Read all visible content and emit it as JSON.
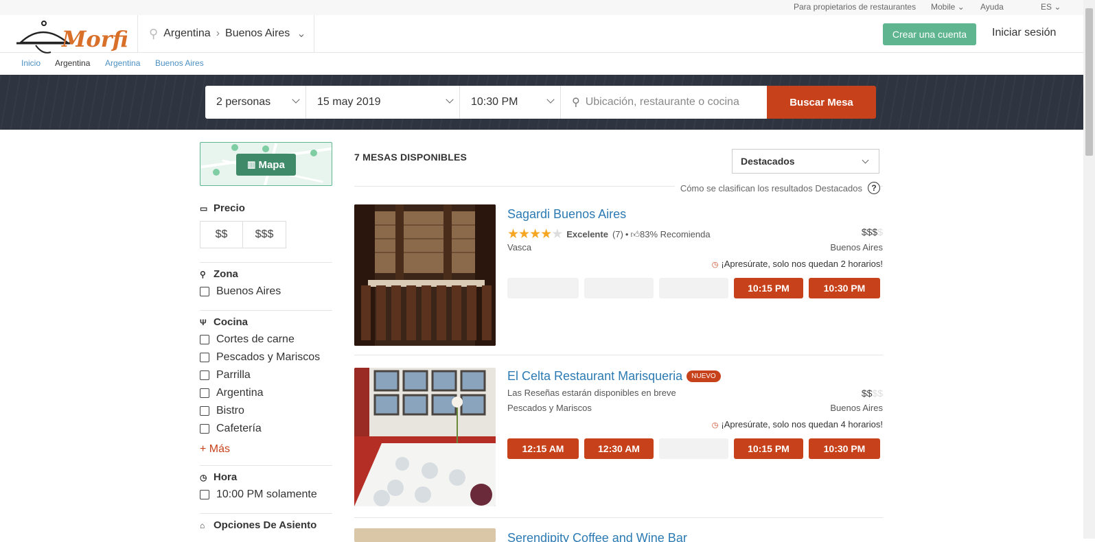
{
  "topbar": {
    "owners": "Para propietarios de restaurantes",
    "mobile": "Mobile",
    "help": "Ayuda",
    "lang": "ES"
  },
  "header": {
    "logo_text": "Morfi",
    "country": "Argentina",
    "city": "Buenos Aires",
    "create_account": "Crear una cuenta",
    "login": "Iniciar sesión"
  },
  "breadcrumb": [
    "Inicio",
    "Argentina",
    "Argentina",
    "Buenos Aires"
  ],
  "search": {
    "party": "2 personas",
    "date": "15 may 2019",
    "time": "10:30 PM",
    "placeholder": "Ubicación, restaurante o cocina",
    "button": "Buscar Mesa"
  },
  "sidebar": {
    "map_button": "Mapa",
    "price_title": "Precio",
    "prices": [
      "$$",
      "$$$"
    ],
    "zone_title": "Zona",
    "zones": [
      "Buenos Aires"
    ],
    "cuisine_title": "Cocina",
    "cuisines": [
      "Cortes de carne",
      "Pescados y Mariscos",
      "Parrilla",
      "Argentina",
      "Bistro",
      "Cafetería"
    ],
    "more": "+ Más",
    "hour_title": "Hora",
    "hours": [
      "10:00 PM solamente"
    ],
    "seating_title": "Opciones De Asiento"
  },
  "results": {
    "count_label": "7 MESAS DISPONIBLES",
    "sort": "Destacados",
    "note": "Cómo se clasifican los resultados Destacados",
    "note_icon": "?",
    "cards": [
      {
        "name": "Sagardi Buenos Aires",
        "badge": "",
        "stars": 4,
        "rating_word": "Excelente",
        "reviews": "(7)",
        "recommend": "83% Recomienda",
        "reviews_text": "",
        "price": "$$$",
        "price_off": "$",
        "cuisine": "Vasca",
        "region": "Buenos Aires",
        "hurry": "¡Apresúrate, solo nos quedan 2 horarios!",
        "slots": [
          "",
          "",
          "",
          "10:15 PM",
          "10:30 PM"
        ]
      },
      {
        "name": "El Celta Restaurant Marisqueria",
        "badge": "NUEVO",
        "reviews_text": "Las Reseñas estarán disponibles en breve",
        "price": "$$",
        "price_off": "$$",
        "cuisine": "Pescados y Mariscos",
        "region": "Buenos Aires",
        "hurry": "¡Apresúrate, solo nos quedan 4 horarios!",
        "slots": [
          "12:15 AM",
          "12:30 AM",
          "",
          "10:15 PM",
          "10:30 PM"
        ]
      },
      {
        "name": "Serendipity Coffee and Wine Bar"
      }
    ]
  },
  "colors": {
    "accent": "#c7411a",
    "green": "#5fb58f",
    "link": "#2b7ab3",
    "band": "#2f3441"
  }
}
